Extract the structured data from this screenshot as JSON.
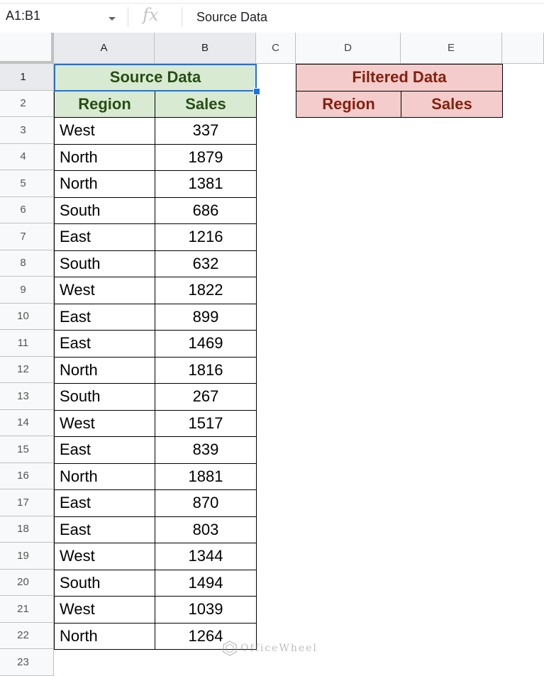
{
  "formula_bar": {
    "name_box": "A1:B1",
    "fx_label": "fx",
    "content": "Source Data"
  },
  "columns": [
    "A",
    "B",
    "C",
    "D",
    "E"
  ],
  "rows": [
    "1",
    "2",
    "3",
    "4",
    "5",
    "6",
    "7",
    "8",
    "9",
    "10",
    "11",
    "12",
    "13",
    "14",
    "15",
    "16",
    "17",
    "18",
    "19",
    "20",
    "21",
    "22",
    "23"
  ],
  "source_table": {
    "title": "Source Data",
    "headers": [
      "Region",
      "Sales"
    ],
    "header_color": "#d9ead3",
    "data": [
      [
        "West",
        "337"
      ],
      [
        "North",
        "1879"
      ],
      [
        "North",
        "1381"
      ],
      [
        "South",
        "686"
      ],
      [
        "East",
        "1216"
      ],
      [
        "South",
        "632"
      ],
      [
        "West",
        "1822"
      ],
      [
        "East",
        "899"
      ],
      [
        "East",
        "1469"
      ],
      [
        "North",
        "1816"
      ],
      [
        "South",
        "267"
      ],
      [
        "West",
        "1517"
      ],
      [
        "East",
        "839"
      ],
      [
        "North",
        "1881"
      ],
      [
        "East",
        "870"
      ],
      [
        "East",
        "803"
      ],
      [
        "West",
        "1344"
      ],
      [
        "South",
        "1494"
      ],
      [
        "West",
        "1039"
      ],
      [
        "North",
        "1264"
      ]
    ]
  },
  "filtered_table": {
    "title": "Filtered Data",
    "headers": [
      "Region",
      "Sales"
    ],
    "header_color": "#f4cccc"
  },
  "selection_accent": "#1a73e8",
  "watermark": {
    "text": "OfficeWheel",
    "icon": "officewheel-logo-icon"
  }
}
